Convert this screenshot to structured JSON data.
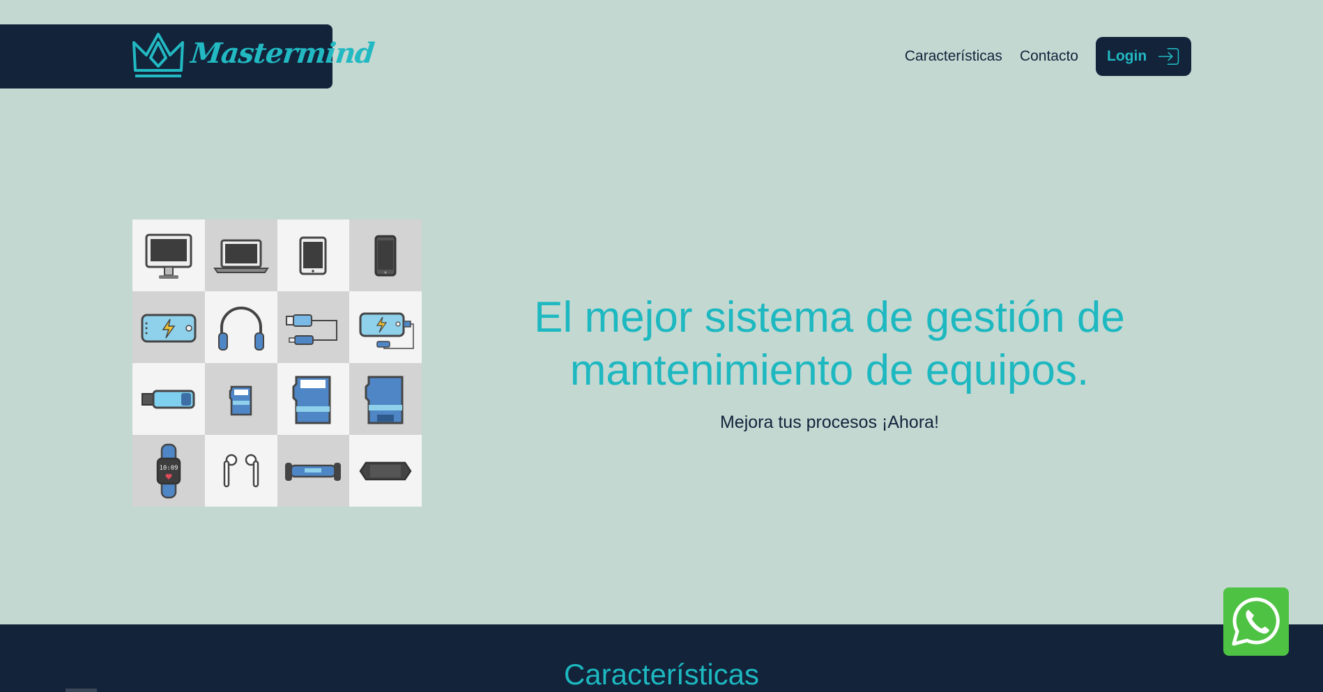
{
  "header": {
    "logo_text": "Mastermind",
    "nav": [
      {
        "label": "Características"
      },
      {
        "label": "Contacto"
      }
    ],
    "login_label": "Login"
  },
  "hero": {
    "title_line1": "El mejor sistema de gestión de",
    "title_line2": "mantenimiento de equipos.",
    "subtitle": "Mejora tus procesos ¡Ahora!",
    "tiles": [
      {
        "icon": "desktop-monitor-icon"
      },
      {
        "icon": "laptop-icon"
      },
      {
        "icon": "tablet-icon"
      },
      {
        "icon": "smartphone-icon"
      },
      {
        "icon": "power-bank-icon"
      },
      {
        "icon": "headphones-icon"
      },
      {
        "icon": "usb-cable-icon"
      },
      {
        "icon": "power-bank-cable-icon"
      },
      {
        "icon": "usb-flash-drive-icon"
      },
      {
        "icon": "micro-sd-card-icon"
      },
      {
        "icon": "sd-card-icon"
      },
      {
        "icon": "sd-adapter-icon"
      },
      {
        "icon": "smartwatch-icon"
      },
      {
        "icon": "earbuds-icon"
      },
      {
        "icon": "hoverboard-icon"
      },
      {
        "icon": "game-console-icon"
      }
    ]
  },
  "features": {
    "title": "Características"
  },
  "colors": {
    "background": "#c4d8d2",
    "navy": "#12233a",
    "accent": "#1db8c0",
    "whatsapp": "#4ec243"
  }
}
